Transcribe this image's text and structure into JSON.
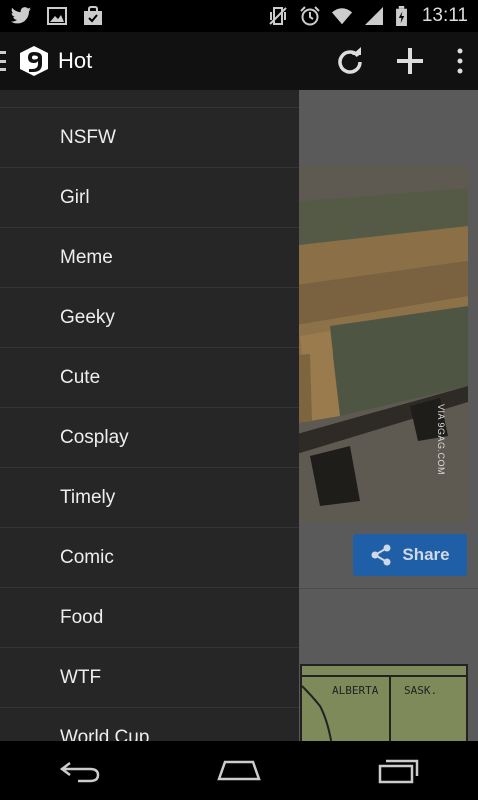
{
  "status_bar": {
    "time": "13:11",
    "left_icons": [
      "twitter-icon",
      "image-icon",
      "shopping-bag-icon"
    ],
    "right_icons": [
      "vibrate-icon",
      "alarm-icon",
      "wifi-icon",
      "signal-icon",
      "battery-icon"
    ]
  },
  "action_bar": {
    "title": "Hot",
    "actions": [
      "refresh-icon",
      "add-icon",
      "overflow-menu-icon"
    ]
  },
  "drawer": {
    "items": [
      {
        "label": "NSFW"
      },
      {
        "label": "Girl"
      },
      {
        "label": "Meme"
      },
      {
        "label": "Geeky"
      },
      {
        "label": "Cute"
      },
      {
        "label": "Cosplay"
      },
      {
        "label": "Timely"
      },
      {
        "label": "Comic"
      },
      {
        "label": "Food"
      },
      {
        "label": "WTF"
      },
      {
        "label": "World Cup"
      }
    ]
  },
  "content": {
    "watermark": "VIA 9GAG.COM",
    "share_label": "Share",
    "map_labels": [
      "ALBERTA",
      "SASK."
    ]
  },
  "colors": {
    "drawer_bg": "#262626",
    "share_button": "#1f5fa8",
    "action_bar_bg": "#111111"
  }
}
